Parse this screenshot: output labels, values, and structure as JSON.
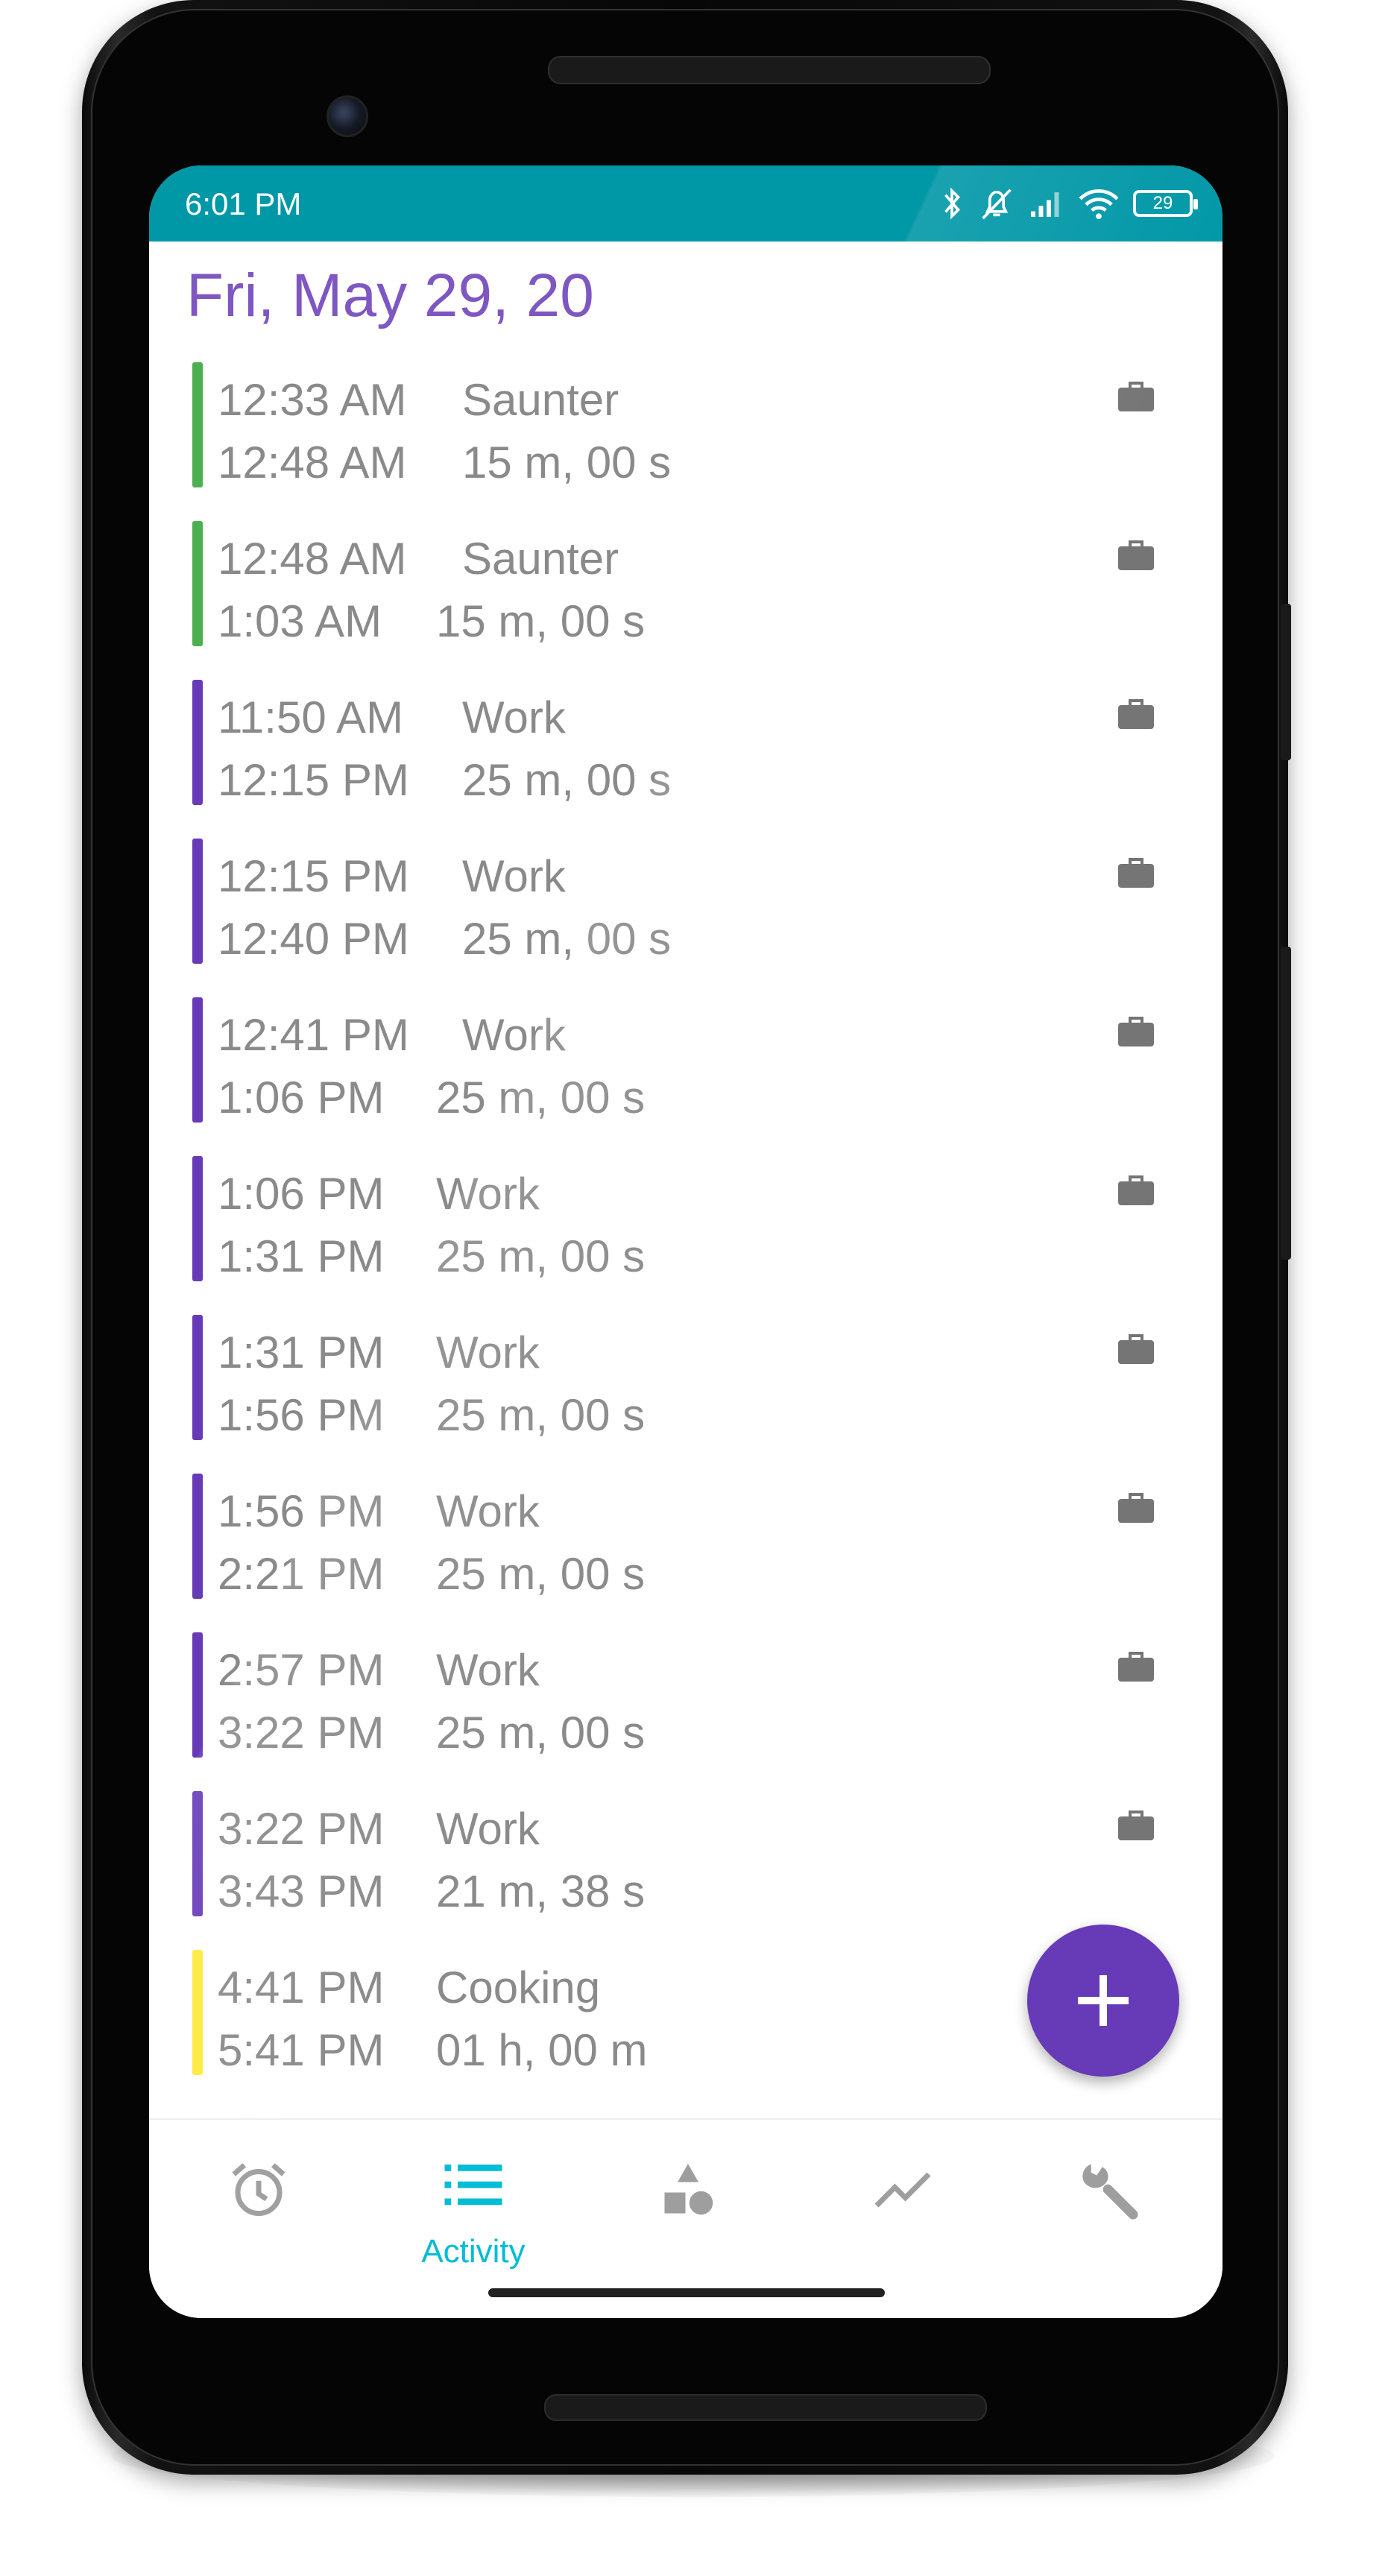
{
  "status_bar": {
    "time": "6:01 PM",
    "battery": "29",
    "icons": [
      "bluetooth-icon",
      "alarm-off-icon",
      "signal-icon",
      "wifi-icon",
      "battery-icon"
    ]
  },
  "header": {
    "date": "Fri, May 29, 20"
  },
  "colors": {
    "status_bar": "#0097a7",
    "date_text": "#7e57c2",
    "saunter": "#4caf50",
    "work": "#673ab7",
    "cooking": "#ffeb3b",
    "fab": "#673ab7",
    "nav_active": "#00bcd4",
    "nav_inactive": "#9e9e9e"
  },
  "entries": [
    {
      "start": "12:33 AM",
      "end": "12:48 AM",
      "activity": "Saunter",
      "duration": "15 m, 00 s",
      "color": "#4caf50",
      "icon": "briefcase-icon"
    },
    {
      "start": "12:48 AM",
      "end": "1:03 AM",
      "activity": "Saunter",
      "duration": "15 m, 00 s",
      "color": "#4caf50",
      "icon": "briefcase-icon"
    },
    {
      "start": "11:50 AM",
      "end": "12:15 PM",
      "activity": "Work",
      "duration": "25 m, 00 s",
      "color": "#673ab7",
      "icon": "briefcase-icon"
    },
    {
      "start": "12:15 PM",
      "end": "12:40 PM",
      "activity": "Work",
      "duration": "25 m, 00 s",
      "color": "#673ab7",
      "icon": "briefcase-icon"
    },
    {
      "start": "12:41 PM",
      "end": "1:06 PM",
      "activity": "Work",
      "duration": "25 m, 00 s",
      "color": "#673ab7",
      "icon": "briefcase-icon"
    },
    {
      "start": "1:06 PM",
      "end": "1:31 PM",
      "activity": "Work",
      "duration": "25 m, 00 s",
      "color": "#673ab7",
      "icon": "briefcase-icon"
    },
    {
      "start": "1:31 PM",
      "end": "1:56 PM",
      "activity": "Work",
      "duration": "25 m, 00 s",
      "color": "#673ab7",
      "icon": "briefcase-icon"
    },
    {
      "start": "1:56 PM",
      "end": "2:21 PM",
      "activity": "Work",
      "duration": "25 m, 00 s",
      "color": "#673ab7",
      "icon": "briefcase-icon"
    },
    {
      "start": "2:57 PM",
      "end": "3:22 PM",
      "activity": "Work",
      "duration": "25 m, 00 s",
      "color": "#673ab7",
      "icon": "briefcase-icon"
    },
    {
      "start": "3:22 PM",
      "end": "3:43 PM",
      "activity": "Work",
      "duration": "21 m, 38 s",
      "color": "#673ab7",
      "icon": "briefcase-icon"
    },
    {
      "start": "4:41 PM",
      "end": "5:41 PM",
      "activity": "Cooking",
      "duration": "01 h, 00 m",
      "color": "#ffeb3b",
      "icon": ""
    }
  ],
  "fab": {
    "icon": "plus-icon"
  },
  "bottom_nav": {
    "items": [
      {
        "name": "alarm",
        "icon": "alarm-clock-icon",
        "label": "",
        "active": false
      },
      {
        "name": "activity",
        "icon": "list-icon",
        "label": "Activity",
        "active": true
      },
      {
        "name": "categories",
        "icon": "shapes-icon",
        "label": "",
        "active": false
      },
      {
        "name": "statistics",
        "icon": "trending-icon",
        "label": "",
        "active": false
      },
      {
        "name": "settings",
        "icon": "wrench-icon",
        "label": "",
        "active": false
      }
    ]
  }
}
